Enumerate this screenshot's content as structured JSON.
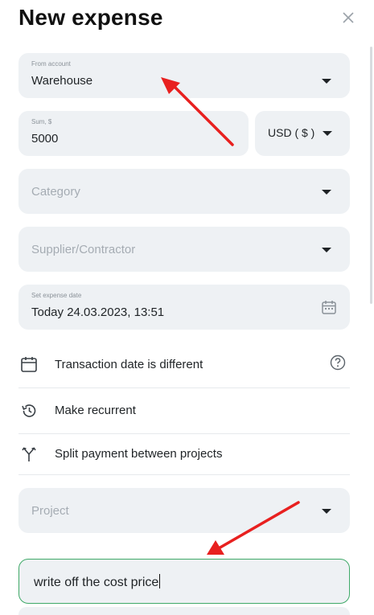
{
  "dialog": {
    "title": "New expense"
  },
  "from_account": {
    "label": "From account",
    "value": "Warehouse"
  },
  "sum": {
    "label": "Sum, $",
    "value": "5000"
  },
  "currency": {
    "value": "USD ( $ )"
  },
  "category": {
    "placeholder": "Category"
  },
  "supplier": {
    "placeholder": "Supplier/Contractor"
  },
  "expense_date": {
    "label": "Set expense date",
    "value": "Today 24.03.2023, 13:51"
  },
  "options": {
    "transaction_date": "Transaction date is different",
    "recurrent": "Make recurrent",
    "split": "Split payment between projects"
  },
  "project": {
    "placeholder": "Project"
  },
  "comment": {
    "value": "write off the cost price"
  },
  "colors": {
    "accent": "#3fa968",
    "annotation_arrow": "#e8201f",
    "field_bg": "#eef1f4"
  }
}
